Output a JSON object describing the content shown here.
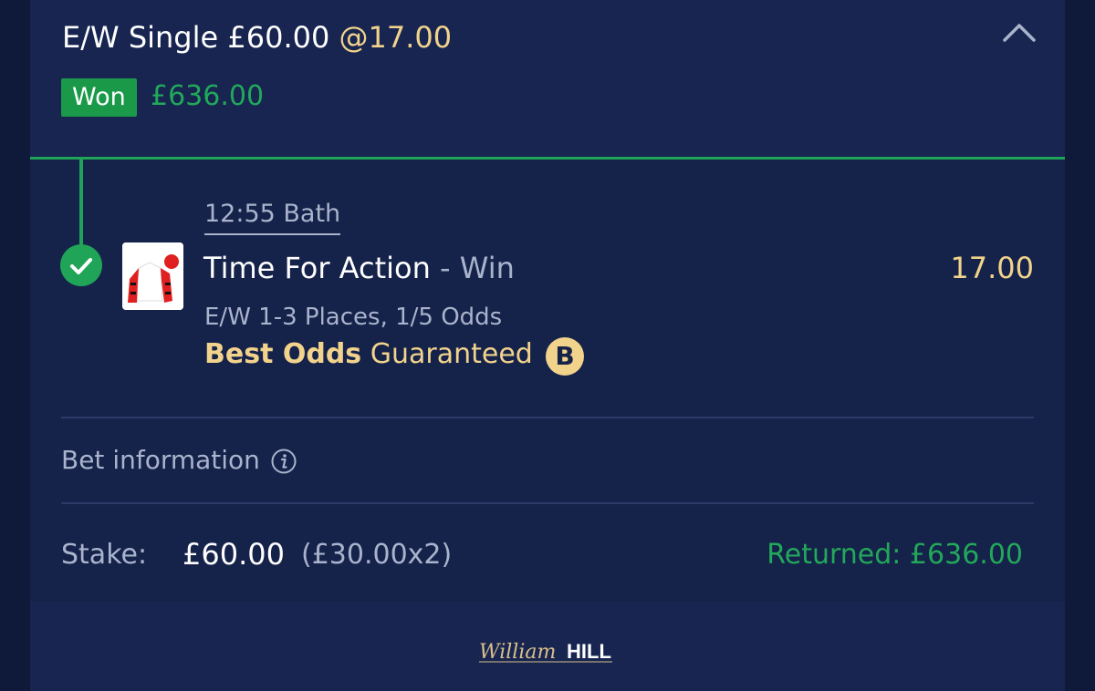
{
  "header": {
    "bet_type": "E/W Single £60.00",
    "odds": "@17.00",
    "status_badge": "Won",
    "won_amount": "£636.00"
  },
  "selection": {
    "race_time": "12:55 Bath",
    "runner_name": "Time For Action",
    "dash": "-",
    "market": "Win",
    "price": "17.00",
    "each_way_terms": "E/W 1-3 Places, 1/5 Odds",
    "best_odds_bold": "Best Odds",
    "best_odds_rest": "Guaranteed",
    "best_odds_icon_letter": "B"
  },
  "bet_info": {
    "label": "Bet information"
  },
  "summary": {
    "stake_label": "Stake:",
    "stake_amount": "£60.00",
    "stake_split": "(£30.00x2)",
    "returned": "Returned: £636.00"
  },
  "footer": {
    "logo_script": "William",
    "logo_bold": "HILL"
  },
  "colors": {
    "background": "#172550",
    "accent_green": "#1fa458",
    "odds_gold": "#f2d38c",
    "muted_text": "#aab3cc"
  },
  "icons": [
    "chevron-up-icon",
    "check-icon",
    "jockey-silks-icon",
    "best-odds-b-icon",
    "info-icon"
  ]
}
